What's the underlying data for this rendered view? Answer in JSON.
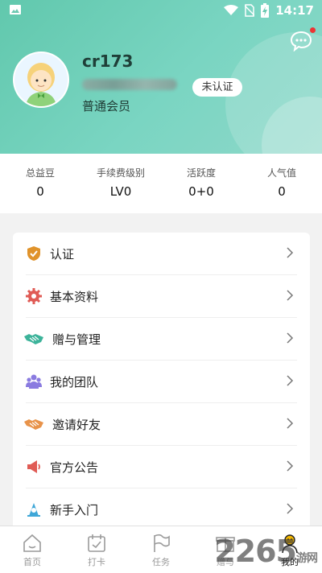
{
  "status_bar": {
    "time": "14:17"
  },
  "profile": {
    "username": "cr173",
    "member_level": "普通会员",
    "verify_badge": "未认证"
  },
  "stats": [
    {
      "label": "总益豆",
      "value": "0"
    },
    {
      "label": "手续费级别",
      "value": "LV0"
    },
    {
      "label": "活跃度",
      "value": "0+0"
    },
    {
      "label": "人气值",
      "value": "0"
    }
  ],
  "menu": [
    {
      "label": "认证",
      "icon": "shield-icon",
      "color": "#e0932b"
    },
    {
      "label": "基本资料",
      "icon": "gear-icon",
      "color": "#e05b55"
    },
    {
      "label": "赠与管理",
      "icon": "handshake-icon",
      "color": "#3cb39a"
    },
    {
      "label": "我的团队",
      "icon": "team-icon",
      "color": "#8a7be0"
    },
    {
      "label": "邀请好友",
      "icon": "invite-icon",
      "color": "#e8934a"
    },
    {
      "label": "官方公告",
      "icon": "megaphone-icon",
      "color": "#e05b55"
    },
    {
      "label": "新手入门",
      "icon": "beginner-icon",
      "color": "#3fa7d8"
    }
  ],
  "nav": [
    {
      "label": "首页",
      "icon": "home-icon"
    },
    {
      "label": "打卡",
      "icon": "checkin-icon"
    },
    {
      "label": "任务",
      "icon": "flag-icon"
    },
    {
      "label": "赠与",
      "icon": "gift-icon"
    },
    {
      "label": "我的",
      "icon": "user-icon"
    }
  ],
  "watermark": {
    "text": "2265",
    "suffix": "游网"
  },
  "colors": {
    "header_start": "#61c8ad",
    "header_end": "#8ed8c9",
    "active_nav": "#f2b600"
  }
}
